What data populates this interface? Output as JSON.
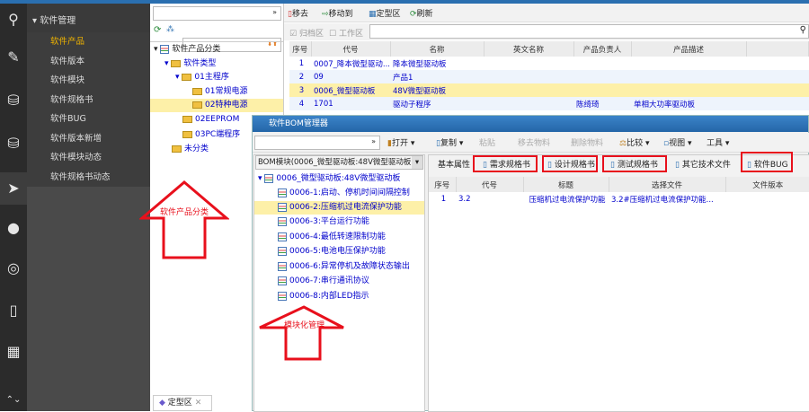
{
  "colors": {
    "accent": "#2a6fb0",
    "annotation": "#e8101c",
    "selected": "#fdf0a8",
    "link": "#0000cc"
  },
  "sidebar_icons": [
    "search-qpm-icon",
    "edit-icon",
    "database-gear-icon",
    "database-icon",
    "send-icon",
    "chat-icon",
    "broadcast-icon",
    "book-icon",
    "calendar-icon"
  ],
  "menu": {
    "header": "软件管理",
    "items": [
      {
        "label": "软件产品",
        "active": true
      },
      {
        "label": "软件版本"
      },
      {
        "label": "软件模块"
      },
      {
        "label": "软件规格书"
      },
      {
        "label": "软件BUG"
      },
      {
        "label": "软件版本新增"
      },
      {
        "label": "软件模块动态"
      },
      {
        "label": "软件规格书动态"
      }
    ]
  },
  "tree": {
    "root": "软件产品分类",
    "nodes": [
      "软件类型",
      "01主程序",
      "01常规电源",
      "02特种电源",
      "02EEPROM",
      "03PC端程序",
      "未分类"
    ]
  },
  "toolbar": {
    "remove": "移去",
    "move_to": "移动到",
    "finalize_area": "定型区",
    "refresh": "刷新"
  },
  "filters": {
    "archive": "归档区",
    "work": "工作区"
  },
  "table": {
    "columns": [
      "序号",
      "代号",
      "名称",
      "英文名称",
      "产品负责人",
      "产品描述"
    ],
    "rows": [
      [
        "1",
        "0007_降本微型驱动...",
        "降本微型驱动板",
        "",
        "",
        ""
      ],
      [
        "2",
        "09",
        "产品1",
        "",
        "",
        ""
      ],
      [
        "3",
        "0006_微型驱动板",
        "48V微型驱动板",
        "",
        "",
        ""
      ],
      [
        "4",
        "1701",
        "驱动子程序",
        "",
        "陈绮琦",
        "单相大功率驱动板"
      ]
    ]
  },
  "dialog": {
    "title": "软件BOM管理器",
    "toolbar": {
      "open": "打开",
      "copy": "复制",
      "paste": "粘贴",
      "remove_material": "移去物料",
      "delete_material": "删除物料",
      "compare": "比较",
      "view": "视图",
      "tools": "工具"
    },
    "bom_select": "BOM模块(0006_微型驱动板:48V微型驱动板",
    "bom_tree": {
      "root": "0006_微型驱动板:48V微型驱动板",
      "children": [
        "0006-1:启动、停机时间间隔控制",
        "0006-2:压缩机过电流保护功能",
        "0006-3:平台运行功能",
        "0006-4:最低转速限制功能",
        "0006-5:电池电压保护功能",
        "0006-6:异常停机及故障状态输出",
        "0006-7:串行通讯协议",
        "0006-8:内部LED指示"
      ]
    },
    "tabs": [
      "基本属性",
      "需求规格书",
      "设计规格书",
      "测试规格书",
      "其它技术文件",
      "软件BUG"
    ],
    "doc_table": {
      "columns": [
        "序号",
        "代号",
        "标题",
        "选择文件",
        "文件版本"
      ],
      "rows": [
        [
          "1",
          "3.2",
          "压缩机过电流保护功能",
          "3.2#压缩机过电流保护功能...",
          ""
        ]
      ]
    }
  },
  "annotations": {
    "tree": "软件产品分类",
    "module": "模块化管理"
  },
  "bottom_tab": "定型区"
}
